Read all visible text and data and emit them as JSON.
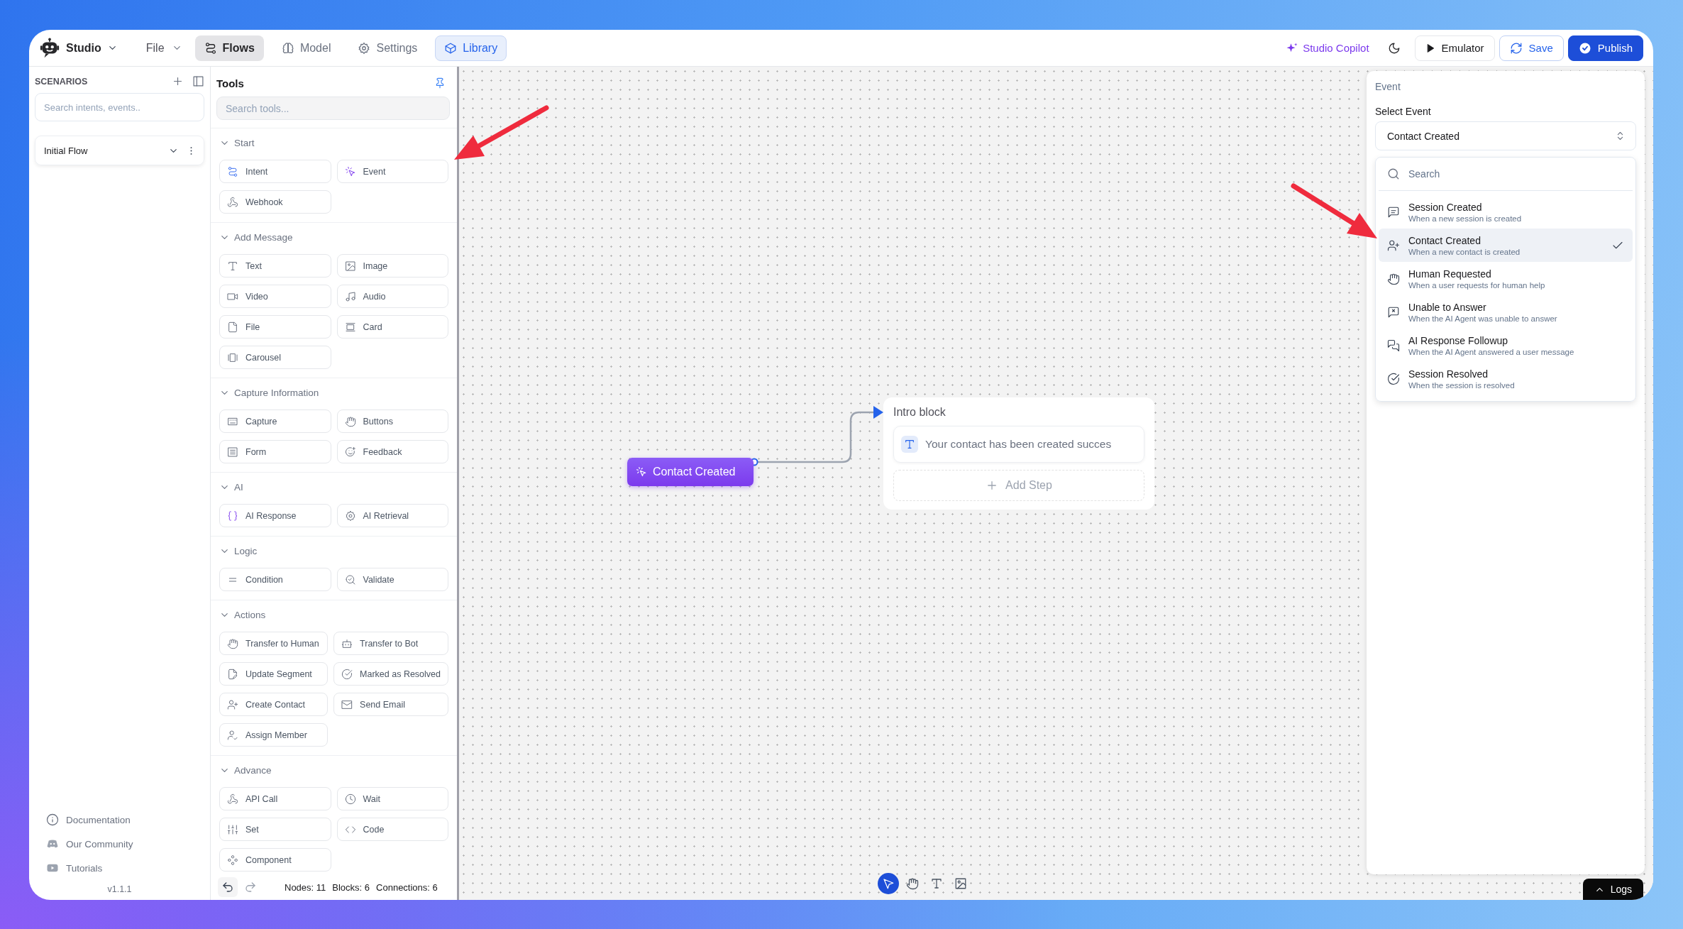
{
  "topbar": {
    "app_name": "Studio",
    "file_menu": "File",
    "nav": [
      {
        "label": "Flows",
        "kind": "flows",
        "selected": true,
        "active": false
      },
      {
        "label": "Model",
        "kind": "model",
        "selected": false,
        "active": false
      },
      {
        "label": "Settings",
        "kind": "settings",
        "selected": false,
        "active": false
      },
      {
        "label": "Library",
        "kind": "library",
        "selected": false,
        "active": true
      }
    ],
    "copilot": "Studio Copilot",
    "emulator": "Emulator",
    "save": "Save",
    "publish": "Publish"
  },
  "sidebar": {
    "title": "SCENARIOS",
    "search_placeholder": "Search intents, events..",
    "flows": [
      {
        "label": "Initial Flow"
      }
    ],
    "links": [
      {
        "label": "Documentation",
        "kind": "info"
      },
      {
        "label": "Our Community",
        "kind": "community"
      },
      {
        "label": "Tutorials",
        "kind": "video"
      }
    ],
    "version": "v1.1.1"
  },
  "tools": {
    "title": "Tools",
    "search_placeholder": "Search tools...",
    "sections": [
      {
        "title": "Start",
        "expanded": true,
        "items": [
          {
            "label": "Intent",
            "kind": "intent"
          },
          {
            "label": "Event",
            "kind": "event"
          },
          {
            "label": "Webhook",
            "kind": "webhook"
          }
        ]
      },
      {
        "title": "Add Message",
        "expanded": true,
        "items": [
          {
            "label": "Text",
            "kind": "text"
          },
          {
            "label": "Image",
            "kind": "image"
          },
          {
            "label": "Video",
            "kind": "video"
          },
          {
            "label": "Audio",
            "kind": "audio"
          },
          {
            "label": "File",
            "kind": "file"
          },
          {
            "label": "Card",
            "kind": "card"
          },
          {
            "label": "Carousel",
            "kind": "carousel"
          }
        ]
      },
      {
        "title": "Capture Information",
        "expanded": true,
        "items": [
          {
            "label": "Capture",
            "kind": "capture"
          },
          {
            "label": "Buttons",
            "kind": "buttons"
          },
          {
            "label": "Form",
            "kind": "form"
          },
          {
            "label": "Feedback",
            "kind": "feedback"
          }
        ]
      },
      {
        "title": "AI",
        "expanded": true,
        "items": [
          {
            "label": "AI Response",
            "kind": "ai_response"
          },
          {
            "label": "AI Retrieval",
            "kind": "ai_retrieval"
          }
        ]
      },
      {
        "title": "Logic",
        "expanded": true,
        "items": [
          {
            "label": "Condition",
            "kind": "condition"
          },
          {
            "label": "Validate",
            "kind": "validate"
          }
        ]
      },
      {
        "title": "Actions",
        "expanded": true,
        "items": [
          {
            "label": "Transfer to Human",
            "kind": "human"
          },
          {
            "label": "Transfer to Bot",
            "kind": "bot"
          },
          {
            "label": "Update Segment",
            "kind": "segment"
          },
          {
            "label": "Marked as Resolved",
            "kind": "resolved"
          },
          {
            "label": "Create Contact",
            "kind": "contact"
          },
          {
            "label": "Send Email",
            "kind": "email"
          },
          {
            "label": "Assign Member",
            "kind": "member"
          }
        ]
      },
      {
        "title": "Advance",
        "expanded": true,
        "items": [
          {
            "label": "API Call",
            "kind": "webhook"
          },
          {
            "label": "Wait",
            "kind": "wait"
          },
          {
            "label": "Set",
            "kind": "set"
          },
          {
            "label": "Code",
            "kind": "code"
          },
          {
            "label": "Component",
            "kind": "component"
          }
        ]
      }
    ],
    "stats": [
      "Nodes: 11",
      "Blocks: 6",
      "Connections: 6"
    ]
  },
  "canvas": {
    "trigger": {
      "label": "Contact Created"
    },
    "block": {
      "title": "Intro block",
      "steps": [
        {
          "text": "Your contact has been created succes"
        }
      ],
      "add_label": "Add Step"
    },
    "toolbar": [
      {
        "kind": "pointer",
        "selected": true
      },
      {
        "kind": "hand",
        "selected": false
      },
      {
        "kind": "text",
        "selected": false
      },
      {
        "kind": "image",
        "selected": false
      }
    ],
    "logs": "Logs"
  },
  "event_panel": {
    "heading": "Event",
    "field_label": "Select Event",
    "value": "Contact Created",
    "search_placeholder": "Search",
    "options": [
      {
        "title": "Session Created",
        "description": "When a new session is created",
        "kind": "message",
        "selected": false
      },
      {
        "title": "Contact Created",
        "description": "When a new contact is created",
        "kind": "contact",
        "selected": true
      },
      {
        "title": "Human Requested",
        "description": "When a user requests for human help",
        "kind": "human",
        "selected": false
      },
      {
        "title": "Unable to Answer",
        "description": "When the AI Agent was unable to answer",
        "kind": "message_x",
        "selected": false
      },
      {
        "title": "AI Response Followup",
        "description": "When the AI Agent answered a user message",
        "kind": "messages",
        "selected": false
      },
      {
        "title": "Session Resolved",
        "description": "When the session is resolved",
        "kind": "resolved",
        "selected": false
      }
    ]
  }
}
